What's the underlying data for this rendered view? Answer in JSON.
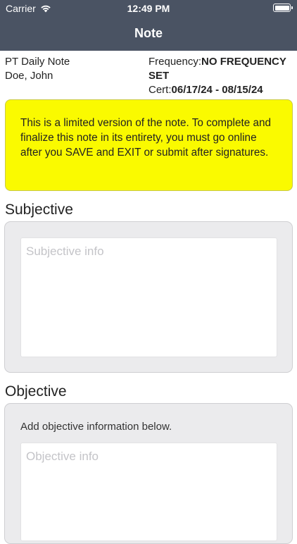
{
  "status_bar": {
    "carrier": "Carrier",
    "time": "12:49 PM"
  },
  "nav": {
    "title": "Note"
  },
  "note_info": {
    "type": "PT Daily Note",
    "patient": "Doe, John",
    "frequency_label": "Frequency:",
    "frequency_value": "NO FREQUENCY SET",
    "cert_label": "Cert:",
    "cert_value": "06/17/24 - 08/15/24"
  },
  "notice": {
    "text": "This is a limited version of the note. To complete and finalize this note in its entirety, you must go online after you SAVE and EXIT or submit after signatures.",
    "background": "#fafa00"
  },
  "subjective": {
    "heading": "Subjective",
    "value": "",
    "placeholder": "Subjective info"
  },
  "objective": {
    "heading": "Objective",
    "instruction": "Add objective information below.",
    "value": "",
    "placeholder": "Objective info"
  },
  "colors": {
    "header": "#4a5363",
    "panel": "#ebebed"
  },
  "icons": {
    "wifi": "wifi-icon",
    "battery": "battery-icon"
  }
}
